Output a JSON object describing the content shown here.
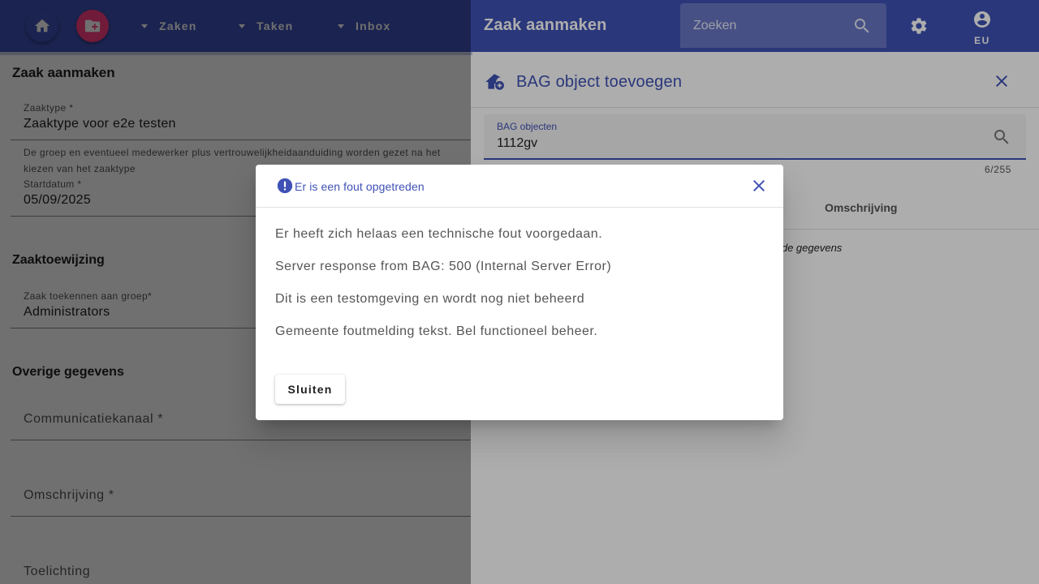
{
  "topbar": {
    "menus": [
      "Zaken",
      "Taken",
      "Inbox"
    ],
    "title": "Zaak aanmaken",
    "search_placeholder": "Zoeken",
    "user_label": "EU"
  },
  "form": {
    "heading": "Zaak aanmaken",
    "zaaktype_label": "Zaaktype *",
    "zaaktype_value": "Zaaktype voor e2e testen",
    "hint": "De groep en eventueel medewerker plus vertrouwelijkheidaanduiding worden gezet na het kiezen van het zaaktype",
    "startdatum_label": "Startdatum *",
    "startdatum_value": "05/09/2025",
    "toewijzing_heading": "Zaaktoewijzing",
    "groep_label": "Zaak toekennen aan groep*",
    "groep_value": "Administrators",
    "overige_heading": "Overige gegevens",
    "communicatiekanaal": "Communicatiekanaal *",
    "omschrijving": "Omschrijving *",
    "toelichting": "Toelichting"
  },
  "panel": {
    "title": "BAG object toevoegen",
    "field_label": "BAG objecten",
    "field_value": "1112gv",
    "counter": "6/255",
    "column_header": "Omschrijving",
    "no_data": "n de gegevens"
  },
  "dialog": {
    "title": "Er is een fout opgetreden",
    "lines": [
      "Er heeft zich helaas een technische fout voorgedaan.",
      "Server response from BAG: 500 (Internal Server Error)",
      "Dit is een testomgeving en wordt nog niet beheerd",
      "Gemeente foutmelding tekst. Bel functioneel beheer."
    ],
    "close_button": "Sluiten"
  },
  "colors": {
    "primary": "#3f51b5",
    "accent": "#ff4081"
  }
}
